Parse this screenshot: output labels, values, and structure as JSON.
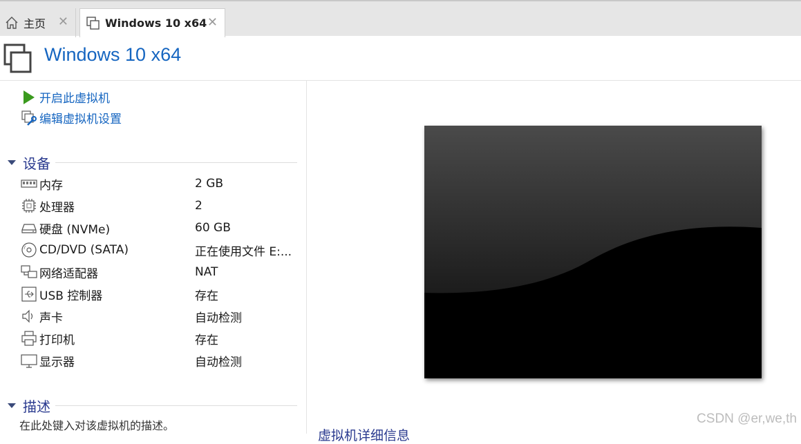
{
  "tabs": [
    {
      "label": "主页",
      "icon": "home-icon"
    },
    {
      "label": "Windows 10 x64",
      "icon": "vm-icon"
    }
  ],
  "tab_close_glyph": "✕",
  "vm_title": "Windows 10 x64",
  "actions": [
    {
      "label": "开启此虚拟机",
      "icon": "power-on-play-icon"
    },
    {
      "label": "编辑虚拟机设置",
      "icon": "edit-settings-icon"
    }
  ],
  "devices_section": {
    "label": "设备"
  },
  "devices": [
    {
      "name": "内存",
      "value": "2 GB",
      "icon": "memory-icon"
    },
    {
      "name": "处理器",
      "value": "2",
      "icon": "processor-icon"
    },
    {
      "name": "硬盘 (NVMe)",
      "value": "60 GB",
      "icon": "hard-disk-icon"
    },
    {
      "name": "CD/DVD (SATA)",
      "value": "正在使用文件 E:...",
      "icon": "cd-dvd-icon"
    },
    {
      "name": "网络适配器",
      "value": "NAT",
      "icon": "network-adapter-icon"
    },
    {
      "name": "USB 控制器",
      "value": "存在",
      "icon": "usb-icon"
    },
    {
      "name": "声卡",
      "value": "自动检测",
      "icon": "sound-card-icon"
    },
    {
      "name": "打印机",
      "value": "存在",
      "icon": "printer-icon"
    },
    {
      "name": "显示器",
      "value": "自动检测",
      "icon": "display-icon"
    }
  ],
  "description_section": {
    "label": "描述",
    "placeholder": "在此处键入对该虚拟机的描述。"
  },
  "details_section": {
    "label": "虚拟机详细信息"
  },
  "watermark": "CSDN @er,we,th",
  "colors": {
    "accent": "#1565c0",
    "section_header": "#2a3a8f",
    "play_green": "#3a9a1e",
    "tab_bar": "#e6e6e6"
  }
}
